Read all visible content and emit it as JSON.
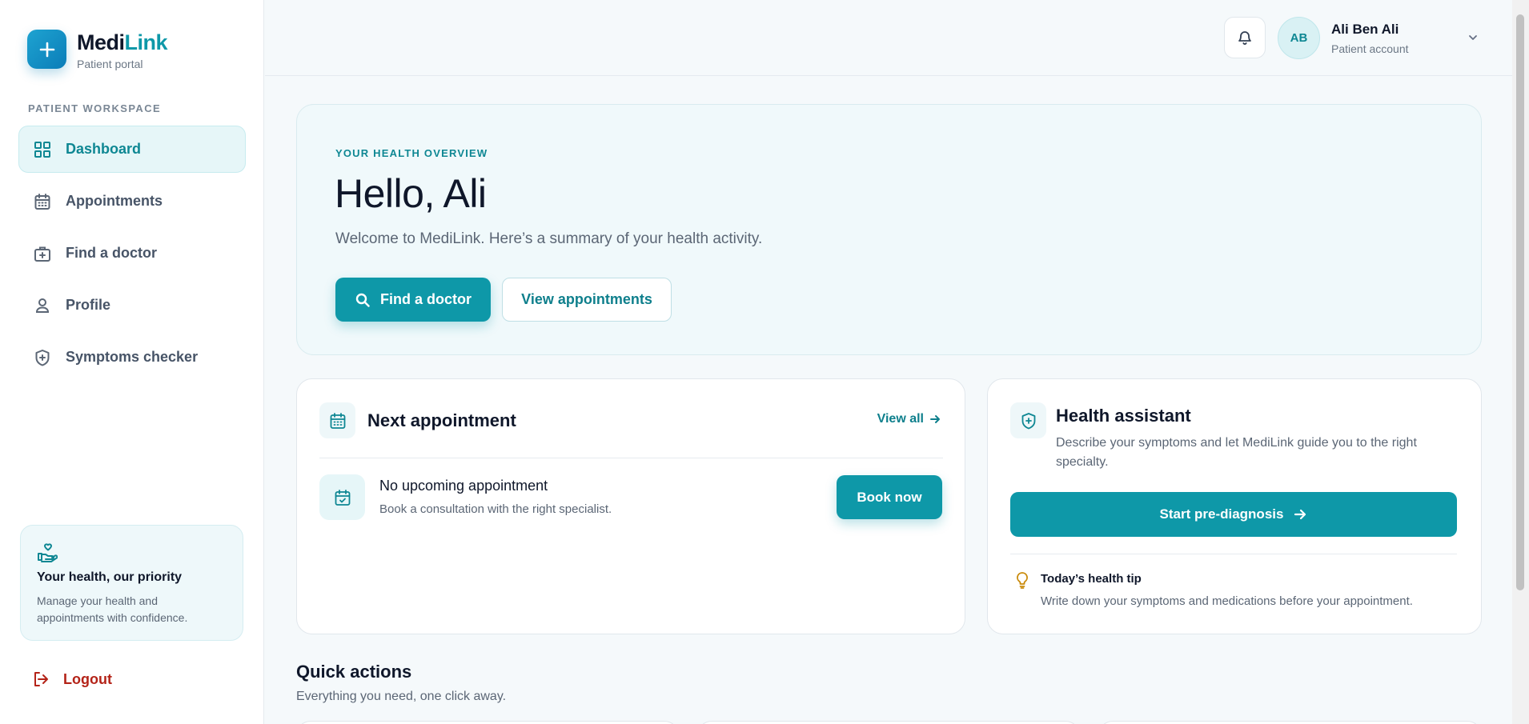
{
  "brand": {
    "name_part1": "Medi",
    "name_part2": "Link",
    "subtitle": "Patient portal"
  },
  "sidebar": {
    "section_label": "PATIENT WORKSPACE",
    "items": [
      {
        "label": "Dashboard",
        "icon": "grid-icon",
        "active": true
      },
      {
        "label": "Appointments",
        "icon": "calendar-icon",
        "active": false
      },
      {
        "label": "Find a doctor",
        "icon": "medical-bag-icon",
        "active": false
      },
      {
        "label": "Profile",
        "icon": "user-icon",
        "active": false
      },
      {
        "label": "Symptoms checker",
        "icon": "shield-plus-icon",
        "active": false
      }
    ],
    "promo": {
      "title": "Your health, our priority",
      "text": "Manage your health and appointments with confidence."
    },
    "logout_label": "Logout"
  },
  "topbar": {
    "user": {
      "initials": "AB",
      "name": "Ali Ben Ali",
      "role": "Patient account"
    }
  },
  "hero": {
    "eyebrow": "YOUR HEALTH OVERVIEW",
    "title": "Hello, Ali",
    "subtitle": "Welcome to MediLink. Here’s a summary of your health activity.",
    "primary_button": "Find a doctor",
    "secondary_button": "View appointments"
  },
  "next_appointment": {
    "title": "Next appointment",
    "view_all": "View all",
    "empty_title": "No upcoming appointment",
    "empty_text": "Book a consultation with the right specialist.",
    "book_button": "Book now"
  },
  "health_assistant": {
    "title": "Health assistant",
    "text": "Describe your symptoms and let MediLink guide you to the right specialty.",
    "button": "Start pre-diagnosis",
    "tip_title": "Today’s health tip",
    "tip_text": "Write down your symptoms and medications before your appointment."
  },
  "quick_actions": {
    "title": "Quick actions",
    "subtitle": "Everything you need, one click away."
  },
  "colors": {
    "primary": "#0e98a8",
    "primary_dark": "#0e8793",
    "danger": "#b42318",
    "tip": "#c98a0a"
  }
}
